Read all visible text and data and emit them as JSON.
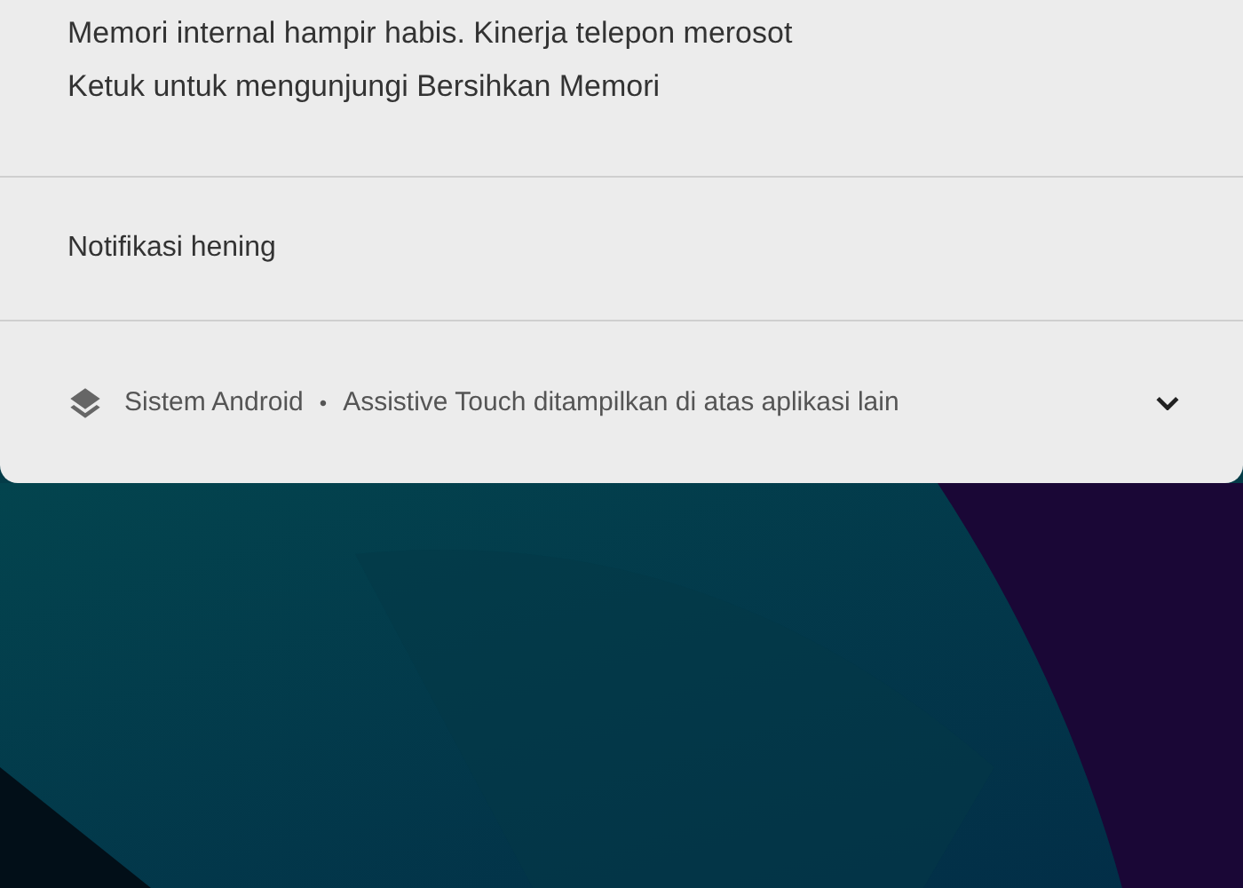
{
  "notification": {
    "lines": [
      "Memori internal hampir habis. Kinerja telepon merosot",
      "Ketuk untuk mengunjungi Bersihkan Memori"
    ]
  },
  "silent_section": {
    "title": "Notifikasi hening"
  },
  "silent_notification": {
    "app": "Sistem Android",
    "separator": "•",
    "text": "Assistive Touch ditampilkan di atas aplikasi lain",
    "expanded": false
  }
}
